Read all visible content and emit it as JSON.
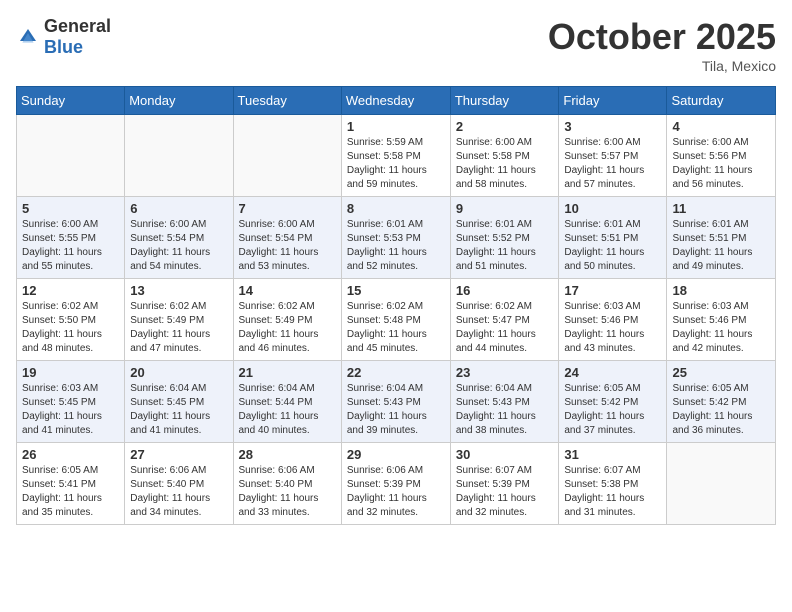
{
  "header": {
    "logo_general": "General",
    "logo_blue": "Blue",
    "month": "October 2025",
    "location": "Tila, Mexico"
  },
  "weekdays": [
    "Sunday",
    "Monday",
    "Tuesday",
    "Wednesday",
    "Thursday",
    "Friday",
    "Saturday"
  ],
  "weeks": [
    [
      {
        "day": "",
        "info": ""
      },
      {
        "day": "",
        "info": ""
      },
      {
        "day": "",
        "info": ""
      },
      {
        "day": "1",
        "info": "Sunrise: 5:59 AM\nSunset: 5:58 PM\nDaylight: 11 hours\nand 59 minutes."
      },
      {
        "day": "2",
        "info": "Sunrise: 6:00 AM\nSunset: 5:58 PM\nDaylight: 11 hours\nand 58 minutes."
      },
      {
        "day": "3",
        "info": "Sunrise: 6:00 AM\nSunset: 5:57 PM\nDaylight: 11 hours\nand 57 minutes."
      },
      {
        "day": "4",
        "info": "Sunrise: 6:00 AM\nSunset: 5:56 PM\nDaylight: 11 hours\nand 56 minutes."
      }
    ],
    [
      {
        "day": "5",
        "info": "Sunrise: 6:00 AM\nSunset: 5:55 PM\nDaylight: 11 hours\nand 55 minutes."
      },
      {
        "day": "6",
        "info": "Sunrise: 6:00 AM\nSunset: 5:54 PM\nDaylight: 11 hours\nand 54 minutes."
      },
      {
        "day": "7",
        "info": "Sunrise: 6:00 AM\nSunset: 5:54 PM\nDaylight: 11 hours\nand 53 minutes."
      },
      {
        "day": "8",
        "info": "Sunrise: 6:01 AM\nSunset: 5:53 PM\nDaylight: 11 hours\nand 52 minutes."
      },
      {
        "day": "9",
        "info": "Sunrise: 6:01 AM\nSunset: 5:52 PM\nDaylight: 11 hours\nand 51 minutes."
      },
      {
        "day": "10",
        "info": "Sunrise: 6:01 AM\nSunset: 5:51 PM\nDaylight: 11 hours\nand 50 minutes."
      },
      {
        "day": "11",
        "info": "Sunrise: 6:01 AM\nSunset: 5:51 PM\nDaylight: 11 hours\nand 49 minutes."
      }
    ],
    [
      {
        "day": "12",
        "info": "Sunrise: 6:02 AM\nSunset: 5:50 PM\nDaylight: 11 hours\nand 48 minutes."
      },
      {
        "day": "13",
        "info": "Sunrise: 6:02 AM\nSunset: 5:49 PM\nDaylight: 11 hours\nand 47 minutes."
      },
      {
        "day": "14",
        "info": "Sunrise: 6:02 AM\nSunset: 5:49 PM\nDaylight: 11 hours\nand 46 minutes."
      },
      {
        "day": "15",
        "info": "Sunrise: 6:02 AM\nSunset: 5:48 PM\nDaylight: 11 hours\nand 45 minutes."
      },
      {
        "day": "16",
        "info": "Sunrise: 6:02 AM\nSunset: 5:47 PM\nDaylight: 11 hours\nand 44 minutes."
      },
      {
        "day": "17",
        "info": "Sunrise: 6:03 AM\nSunset: 5:46 PM\nDaylight: 11 hours\nand 43 minutes."
      },
      {
        "day": "18",
        "info": "Sunrise: 6:03 AM\nSunset: 5:46 PM\nDaylight: 11 hours\nand 42 minutes."
      }
    ],
    [
      {
        "day": "19",
        "info": "Sunrise: 6:03 AM\nSunset: 5:45 PM\nDaylight: 11 hours\nand 41 minutes."
      },
      {
        "day": "20",
        "info": "Sunrise: 6:04 AM\nSunset: 5:45 PM\nDaylight: 11 hours\nand 41 minutes."
      },
      {
        "day": "21",
        "info": "Sunrise: 6:04 AM\nSunset: 5:44 PM\nDaylight: 11 hours\nand 40 minutes."
      },
      {
        "day": "22",
        "info": "Sunrise: 6:04 AM\nSunset: 5:43 PM\nDaylight: 11 hours\nand 39 minutes."
      },
      {
        "day": "23",
        "info": "Sunrise: 6:04 AM\nSunset: 5:43 PM\nDaylight: 11 hours\nand 38 minutes."
      },
      {
        "day": "24",
        "info": "Sunrise: 6:05 AM\nSunset: 5:42 PM\nDaylight: 11 hours\nand 37 minutes."
      },
      {
        "day": "25",
        "info": "Sunrise: 6:05 AM\nSunset: 5:42 PM\nDaylight: 11 hours\nand 36 minutes."
      }
    ],
    [
      {
        "day": "26",
        "info": "Sunrise: 6:05 AM\nSunset: 5:41 PM\nDaylight: 11 hours\nand 35 minutes."
      },
      {
        "day": "27",
        "info": "Sunrise: 6:06 AM\nSunset: 5:40 PM\nDaylight: 11 hours\nand 34 minutes."
      },
      {
        "day": "28",
        "info": "Sunrise: 6:06 AM\nSunset: 5:40 PM\nDaylight: 11 hours\nand 33 minutes."
      },
      {
        "day": "29",
        "info": "Sunrise: 6:06 AM\nSunset: 5:39 PM\nDaylight: 11 hours\nand 32 minutes."
      },
      {
        "day": "30",
        "info": "Sunrise: 6:07 AM\nSunset: 5:39 PM\nDaylight: 11 hours\nand 32 minutes."
      },
      {
        "day": "31",
        "info": "Sunrise: 6:07 AM\nSunset: 5:38 PM\nDaylight: 11 hours\nand 31 minutes."
      },
      {
        "day": "",
        "info": ""
      }
    ]
  ]
}
